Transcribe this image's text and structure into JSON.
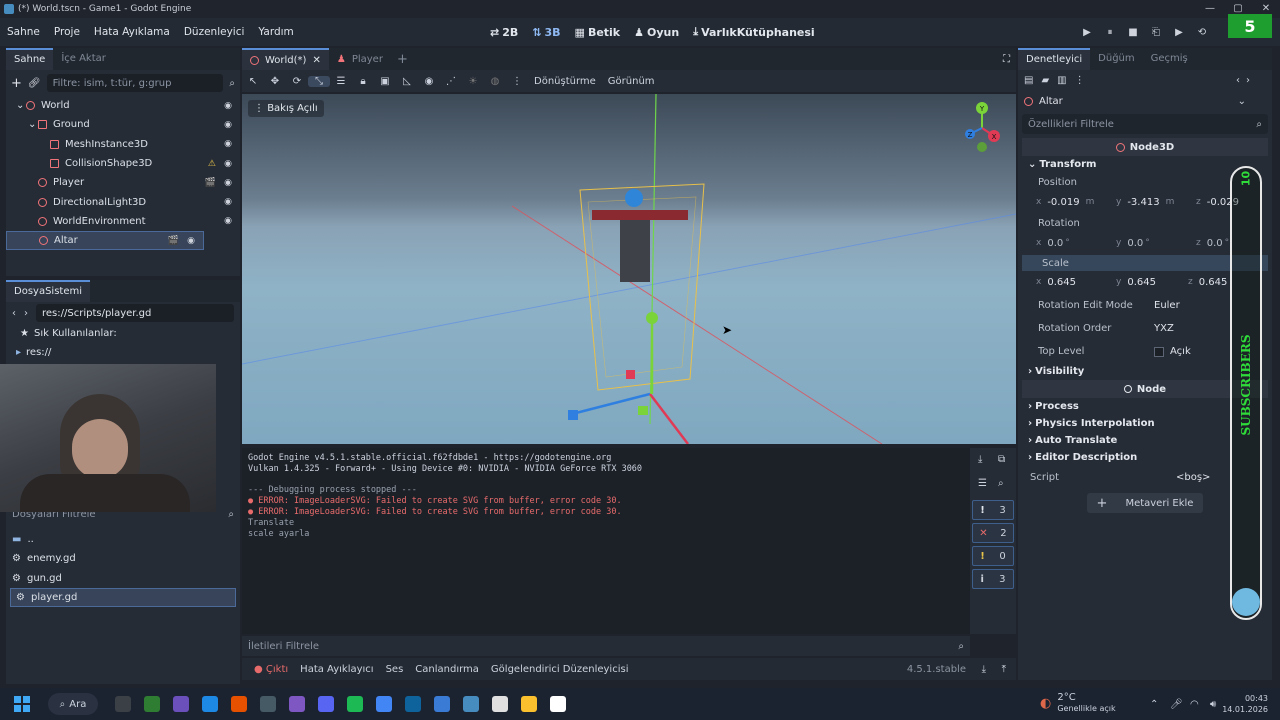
{
  "window": {
    "title": "(*) World.tscn - Game1 - Godot Engine",
    "controls": [
      "—",
      "▢",
      "✕"
    ]
  },
  "menu": [
    "Sahne",
    "Proje",
    "Hata Ayıklama",
    "Düzenleyici",
    "Yardım"
  ],
  "modes": [
    {
      "label": "2B",
      "icon": "⇄"
    },
    {
      "label": "3B",
      "icon": "⇅"
    },
    {
      "label": "Betik",
      "icon": "▦"
    },
    {
      "label": "Oyun",
      "icon": "♟"
    },
    {
      "label": "VarlıkKütüphanesi",
      "icon": "⤓"
    }
  ],
  "run": [
    "▶",
    "⏸",
    "■",
    "⎗",
    "▶",
    "⟲"
  ],
  "scene": {
    "tabs": [
      "Sahne",
      "İçe Aktar"
    ],
    "filter_placeholder": "Filtre: isim, t:tür, g:grup",
    "nodes": [
      {
        "label": "World",
        "icon": "world-icon",
        "color": "#f07479"
      },
      {
        "label": "Ground",
        "icon": "static-body-icon",
        "color": "#f07479"
      },
      {
        "label": "MeshInstance3D",
        "icon": "mesh-icon",
        "color": "#f07479"
      },
      {
        "label": "CollisionShape3D",
        "icon": "collision-shape-icon",
        "color": "#f07479",
        "warning": "⚠"
      },
      {
        "label": "Player",
        "icon": "character-body-icon",
        "color": "#f07479",
        "extra": "🎬"
      },
      {
        "label": "DirectionalLight3D",
        "icon": "light-icon",
        "color": "#f07479"
      },
      {
        "label": "WorldEnvironment",
        "icon": "environment-icon",
        "color": "#f07479"
      },
      {
        "label": "Altar",
        "icon": "node3d-icon",
        "color": "#f07479",
        "extra": "🎬"
      }
    ]
  },
  "filesystem": {
    "tab": "DosyaSistemi",
    "path": "res://Scripts/player.gd",
    "favorites": "Sık Kullanılanlar:",
    "root": "res://",
    "filter_placeholder": "Dosyaları Filtrele",
    "files": [
      "..",
      "enemy.gd",
      "gun.gd",
      "player.gd"
    ]
  },
  "editor_tabs": [
    {
      "label": "World(*)",
      "active": true
    },
    {
      "label": "Player",
      "active": false
    }
  ],
  "viewport": {
    "toolbar_menus": [
      "Dönüştürme",
      "Görünüm"
    ],
    "view_label": "Bakış Açılı",
    "gizmo": {
      "x": "X",
      "y": "Y",
      "z": "Z"
    }
  },
  "console": {
    "lines": [
      {
        "text": "Godot Engine v4.5.1.stable.official.f62fdbde1 - https://godotengine.org",
        "cls": ""
      },
      {
        "text": "Vulkan 1.4.325 - Forward+ - Using Device #0: NVIDIA - NVIDIA GeForce RTX 3060",
        "cls": ""
      },
      {
        "text": "",
        "cls": ""
      },
      {
        "text": "--- Debugging process stopped ---",
        "cls": "muted"
      },
      {
        "text": "● ERROR: ImageLoaderSVG: Failed to create SVG from buffer, error code 30.",
        "cls": "err"
      },
      {
        "text": "● ERROR: ImageLoaderSVG: Failed to create SVG from buffer, error code 30.",
        "cls": "err"
      },
      {
        "text": "Translate",
        "cls": "muted"
      },
      {
        "text": "scale ayarla",
        "cls": "muted"
      }
    ],
    "filter_placeholder": "İletileri Filtrele",
    "counters": [
      {
        "icon": "!",
        "value": "3",
        "color": "#e2e6ed"
      },
      {
        "icon": "✕",
        "value": "2",
        "color": "#e86b6b"
      },
      {
        "icon": "!",
        "value": "0",
        "color": "#e8c44a"
      },
      {
        "icon": "i",
        "value": "3",
        "color": "#cfd4dc"
      }
    ]
  },
  "bottom_tabs": [
    "Çıktı",
    "Hata Ayıklayıcı",
    "Ses",
    "Canlandırma",
    "Gölgelendirici Düzenleyicisi"
  ],
  "version": "4.5.1.stable",
  "inspector": {
    "tabs": [
      "Denetleyici",
      "Düğüm",
      "Geçmiş"
    ],
    "node": "Altar",
    "filter_placeholder": "Özellikleri Filtrele",
    "class": "Node3D",
    "transform": "Transform",
    "position": {
      "label": "Position",
      "x": "-0.019",
      "y": "-3.413",
      "z": "-0.029",
      "unit": "m"
    },
    "rotation": {
      "label": "Rotation",
      "x": "0.0",
      "y": "0.0",
      "z": "0.0",
      "unit": "°"
    },
    "scale": {
      "label": "Scale",
      "x": "0.645",
      "y": "0.645",
      "z": "0.645"
    },
    "rotation_edit_mode": {
      "label": "Rotation Edit Mode",
      "value": "Euler"
    },
    "rotation_order": {
      "label": "Rotation Order",
      "value": "YXZ"
    },
    "top_level": {
      "label": "Top Level",
      "value": "Açık"
    },
    "visibility": "Visibility",
    "node_header": "Node",
    "sections": [
      "Process",
      "Physics Interpolation",
      "Auto Translate",
      "Editor Description"
    ],
    "script": {
      "label": "Script",
      "value": "<boş>"
    },
    "add_meta": "Metaveri Ekle"
  },
  "overlay": {
    "subscribers_label": "SUBSCRIBERS",
    "count": "10",
    "badge": "5"
  },
  "taskbar": {
    "search": "Ara",
    "weather_temp": "2°C",
    "weather_desc": "Genellikle açık",
    "time": "00:43",
    "date": "14.01.2026",
    "apps": [
      "#3b3f46",
      "#2e7d32",
      "#6b4fbb",
      "#1e88e5",
      "#e65100",
      "#455a64",
      "#7e57c2",
      "#5865f2",
      "#1db954",
      "#4285f4",
      "#0e639c",
      "#3a7bd5",
      "#478cbf",
      "#e0e0e0",
      "#fbc02d",
      "#ffffff"
    ]
  }
}
